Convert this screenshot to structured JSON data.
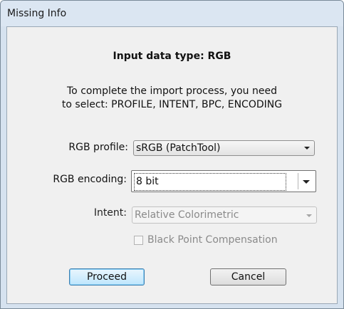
{
  "window": {
    "title": "Missing Info"
  },
  "dialog": {
    "heading": "Input data type: RGB",
    "instruction_line1": "To complete the import process, you need",
    "instruction_line2": "to select: PROFILE, INTENT, BPC, ENCODING"
  },
  "fields": {
    "rgb_profile": {
      "label": "RGB profile:",
      "value": "sRGB (PatchTool)"
    },
    "rgb_encoding": {
      "label": "RGB encoding:",
      "value": "8 bit"
    },
    "intent": {
      "label": "Intent:",
      "value": "Relative Colorimetric",
      "disabled": true
    },
    "bpc": {
      "label": "Black Point Compensation",
      "checked": false,
      "disabled": true
    }
  },
  "buttons": {
    "proceed_label": "Proceed",
    "cancel_label": "Cancel"
  },
  "icons": {
    "dropdown": "chevron-down-icon"
  }
}
